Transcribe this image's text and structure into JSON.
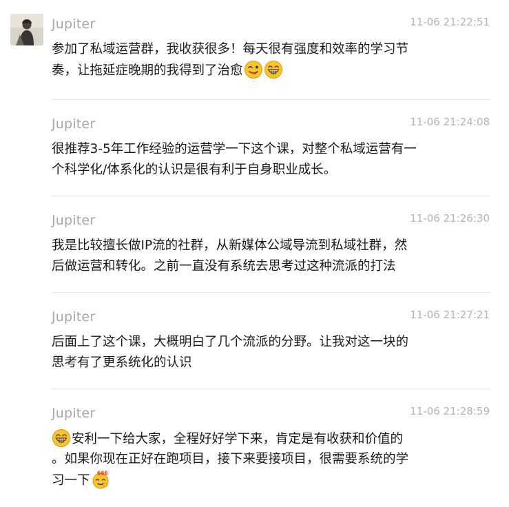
{
  "messages": [
    {
      "author": "Jupiter",
      "time": "11-06 21:22:51",
      "lines": [
        "参加了私域运营群，我收获很多！每天很有强度和效率的学习节",
        "奏，让拖延症晚期的我得到了治愈"
      ],
      "emojis": [
        "wink-tongue-emoji",
        "grin-emoji"
      ]
    },
    {
      "author": "Jupiter",
      "time": "11-06 21:24:08",
      "lines": [
        "很推荐3-5年工作经验的运营学一下这个课，对整个私域运营有一",
        "个科学化/体系化的认识是很有利于自身职业成长。"
      ]
    },
    {
      "author": "Jupiter",
      "time": "11-06 21:26:30",
      "lines": [
        "我是比较擅长做IP流的社群，从新媒体公域导流到私域社群，然",
        "后做运营和转化。之前一直没有系统去思考过这种流派的打法"
      ]
    },
    {
      "author": "Jupiter",
      "time": "11-06 21:27:21",
      "lines": [
        "后面上了这个课，大概明白了几个流派的分野。让我对这一块的",
        "思考有了更系统化的认识"
      ]
    },
    {
      "author": "Jupiter",
      "time": "11-06 21:28:59",
      "lines": [
        "安利一下给大家，全程好好学下来，肯定是有收获和价值的",
        "。如果你现在正好在跑项目，接下来要接项目，很需要系统的学",
        "习一下"
      ],
      "emojis": [
        "grin-emoji",
        "666-emoji"
      ],
      "emoji_666_label": "666"
    }
  ],
  "colors": {
    "name": "#a6a6a6",
    "time": "#b3b3b3",
    "text": "#1a1a1a",
    "divider": "#e6e6e6",
    "emoji_yellow": "#f7c52b"
  }
}
